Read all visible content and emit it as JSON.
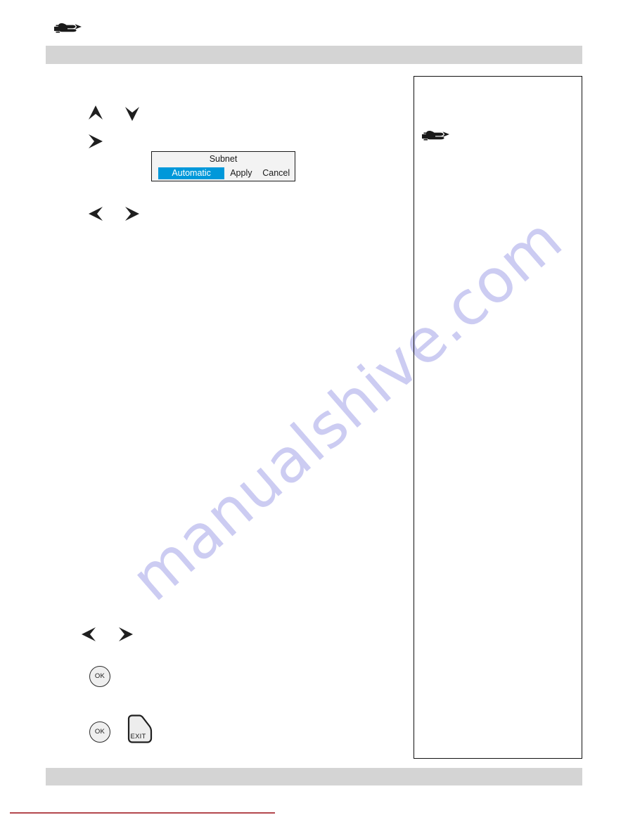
{
  "page": {
    "background_color": "#ffffff",
    "band_color": "#d4d4d4",
    "rule_color": "#b4474d",
    "accent_color": "#0098da"
  },
  "icons": {
    "top_hand": "pointing-hand-icon",
    "note_hand": "pointing-hand-icon",
    "arrow_up": "arrow-up-icon",
    "arrow_down": "arrow-down-icon",
    "arrow_left": "arrow-left-icon",
    "arrow_right": "arrow-right-icon"
  },
  "osd_dialog": {
    "title": "Subnet",
    "selected_option": "Automatic",
    "apply_label": "Apply",
    "cancel_label": "Cancel",
    "highlight_color": "#0098da"
  },
  "keys": {
    "ok_label": "OK",
    "exit_label": "EXIT"
  },
  "watermark": {
    "text": "manualshive.com",
    "color": "#ccccf2"
  }
}
